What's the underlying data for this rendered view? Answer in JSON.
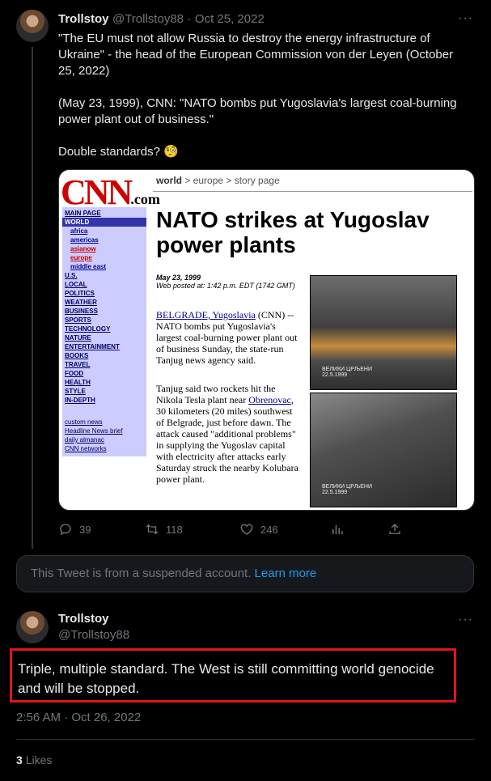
{
  "tweet1": {
    "display_name": "Trollstoy",
    "handle": "@Trollstoy88",
    "separator": "·",
    "date": "Oct 25, 2022",
    "more": "···",
    "text": "\"The EU must not allow Russia to destroy the energy infrastructure of Ukraine\" - the head of the European Commission von der Leyen (October 25, 2022)\n\n(May 23, 1999), CNN: \"NATO bombs put Yugoslavia's largest coal-burning power plant out of business.\"\n\nDouble standards? 🧐",
    "media": {
      "logo": "CNN",
      "logo_suffix": ".com",
      "breadcrumb_world": "world",
      "breadcrumb_rest": " > europe > story page",
      "menu": [
        "MAIN PAGE",
        "WORLD",
        "africa",
        "americas",
        "asianow",
        "europe",
        "middle east",
        "U.S.",
        "LOCAL",
        "POLITICS",
        "WEATHER",
        "BUSINESS",
        "SPORTS",
        "TECHNOLOGY",
        "NATURE",
        "ENTERTAINMENT",
        "BOOKS",
        "TRAVEL",
        "FOOD",
        "HEALTH",
        "STYLE",
        "IN-DEPTH"
      ],
      "menu_footer": [
        "custom news",
        "Headline News brief",
        "daily almanac",
        "CNN networks"
      ],
      "headline": "NATO strikes at Yugoslav power plants",
      "date": "May 23, 1999",
      "posted": "Web posted at: 1:42 p.m. EDT (1742 GMT)",
      "para1_link": "BELGRADE, Yugoslavia",
      "para1": " (CNN) -- NATO bombs put Yugoslavia's largest coal-burning power plant out of business Sunday, the state-run Tanjug news agency said.",
      "para2_a": "Tanjug said two rockets hit the Nikola Tesla plant near ",
      "para2_link": "Obrenovac",
      "para2_b": ", 30 kilometers (20 miles) southwest of Belgrade, just before dawn. The attack caused \"additional problems\" in supplying the Yugoslav capital with electricity after attacks early Saturday struck the nearby Kolubara power plant.",
      "photo1_caption": "ВЕЛИКИ ЦРЉЕНИ\n22.5.1999",
      "photo2_caption": "ВЕЛИКИ ЦРЉЕНИ\n22.5.1999"
    },
    "stats": {
      "replies": "39",
      "retweets": "118",
      "likes": "246"
    }
  },
  "suspended_notice": {
    "text": "This Tweet is from a suspended account. ",
    "link": "Learn more"
  },
  "tweet2": {
    "display_name": "Trollstoy",
    "handle": "@Trollstoy88",
    "more": "···",
    "text": "Triple, multiple standard. The West is still committing world genocide and will be stopped.",
    "timestamp": "2:56 AM · Oct 26, 2022",
    "likes_count": "3",
    "likes_label": "Likes"
  },
  "colors": {
    "highlight": "#e0141e",
    "link": "#1d9bf0"
  }
}
